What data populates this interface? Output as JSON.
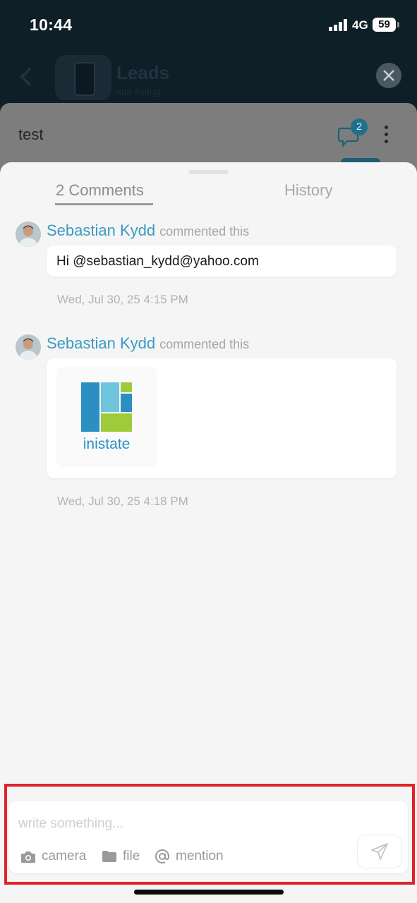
{
  "status_bar": {
    "time": "10:44",
    "network": "4G",
    "battery": "59"
  },
  "background_app": {
    "title": "Leads",
    "subtitle": "sub listing",
    "card_title": "test",
    "comment_badge_count": "2"
  },
  "tabs": [
    {
      "label": "2 Comments",
      "active": true
    },
    {
      "label": "History",
      "active": false
    }
  ],
  "comments": [
    {
      "author": "Sebastian Kydd",
      "action": "commented this",
      "text": "Hi @sebastian_kydd@yahoo.com",
      "timestamp": "Wed, Jul 30, 25 4:15 PM"
    },
    {
      "author": "Sebastian Kydd",
      "action": "commented this",
      "attachment": {
        "type": "image",
        "logo_text": "inistate"
      },
      "timestamp": "Wed, Jul 30, 25 4:18 PM"
    }
  ],
  "composer": {
    "placeholder": "write something...",
    "tools": {
      "camera": "camera",
      "file": "file",
      "mention": "mention"
    }
  },
  "colors": {
    "accent": "#3a9bc4",
    "highlight": "#e0222a",
    "logo_blue": "#2b8fc2",
    "logo_light_blue": "#6fc4dd",
    "logo_green": "#9fcb3b"
  }
}
